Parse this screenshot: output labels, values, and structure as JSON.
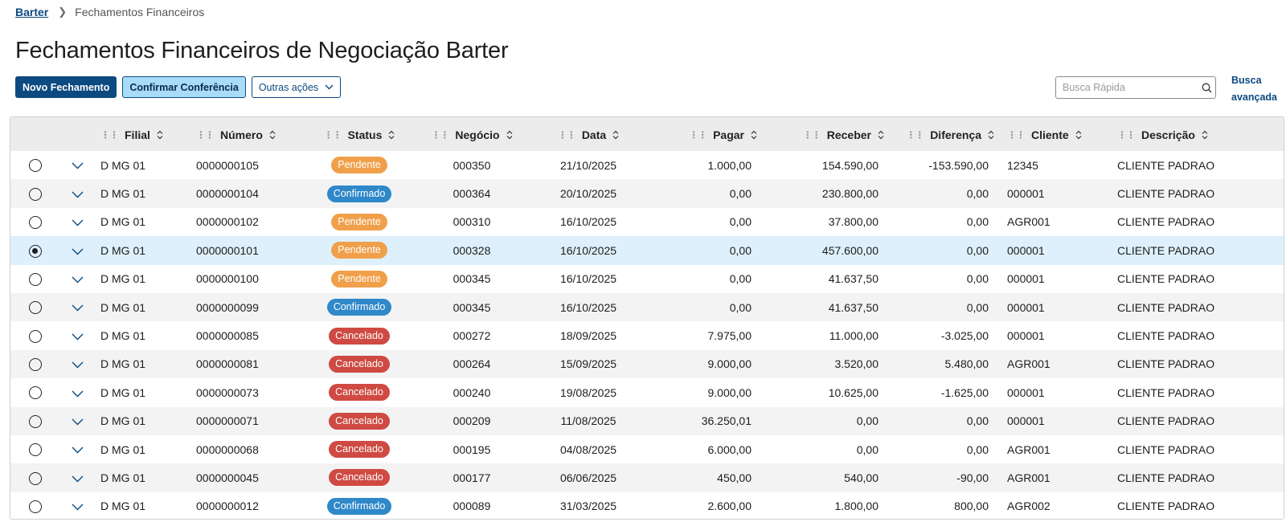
{
  "breadcrumb": {
    "root": "Barter",
    "current": "Fechamentos Financeiros"
  },
  "page_title": "Fechamentos Financeiros de Negociação Barter",
  "toolbar": {
    "new_label": "Novo Fechamento",
    "confirm_label": "Confirmar Conferência",
    "more_label": "Outras ações"
  },
  "search": {
    "placeholder": "Busca Rápida",
    "icon": "search-icon"
  },
  "advanced_search": {
    "line1": "Busca",
    "line2": "avançada"
  },
  "colors": {
    "primary": "#0c4a80",
    "secondary_bg": "#a8dcf8",
    "pendente": "#f0a04a",
    "confirmado": "#2f88c9",
    "cancelado": "#cf4a43",
    "selected_row": "#def0fb"
  },
  "columns": [
    "Filial",
    "Número",
    "Status",
    "Negócio",
    "Data",
    "Pagar",
    "Receber",
    "Diferença",
    "Cliente",
    "Descrição"
  ],
  "rows": [
    {
      "selected": false,
      "filial": "D MG 01",
      "numero": "0000000105",
      "status": "Pendente",
      "negocio": "000350",
      "data": "21/10/2025",
      "pagar": "1.000,00",
      "receber": "154.590,00",
      "diferenca": "-153.590,00",
      "cliente": "12345",
      "descricao": "CLIENTE PADRAO"
    },
    {
      "selected": false,
      "filial": "D MG 01",
      "numero": "0000000104",
      "status": "Confirmado",
      "negocio": "000364",
      "data": "20/10/2025",
      "pagar": "0,00",
      "receber": "230.800,00",
      "diferenca": "0,00",
      "cliente": "000001",
      "descricao": "CLIENTE PADRAO"
    },
    {
      "selected": false,
      "filial": "D MG 01",
      "numero": "0000000102",
      "status": "Pendente",
      "negocio": "000310",
      "data": "16/10/2025",
      "pagar": "0,00",
      "receber": "37.800,00",
      "diferenca": "0,00",
      "cliente": "AGR001",
      "descricao": "CLIENTE PADRAO"
    },
    {
      "selected": true,
      "filial": "D MG 01",
      "numero": "0000000101",
      "status": "Pendente",
      "negocio": "000328",
      "data": "16/10/2025",
      "pagar": "0,00",
      "receber": "457.600,00",
      "diferenca": "0,00",
      "cliente": "000001",
      "descricao": "CLIENTE PADRAO"
    },
    {
      "selected": false,
      "filial": "D MG 01",
      "numero": "0000000100",
      "status": "Pendente",
      "negocio": "000345",
      "data": "16/10/2025",
      "pagar": "0,00",
      "receber": "41.637,50",
      "diferenca": "0,00",
      "cliente": "000001",
      "descricao": "CLIENTE PADRAO"
    },
    {
      "selected": false,
      "filial": "D MG 01",
      "numero": "0000000099",
      "status": "Confirmado",
      "negocio": "000345",
      "data": "16/10/2025",
      "pagar": "0,00",
      "receber": "41.637,50",
      "diferenca": "0,00",
      "cliente": "000001",
      "descricao": "CLIENTE PADRAO"
    },
    {
      "selected": false,
      "filial": "D MG 01",
      "numero": "0000000085",
      "status": "Cancelado",
      "negocio": "000272",
      "data": "18/09/2025",
      "pagar": "7.975,00",
      "receber": "11.000,00",
      "diferenca": "-3.025,00",
      "cliente": "000001",
      "descricao": "CLIENTE PADRAO"
    },
    {
      "selected": false,
      "filial": "D MG 01",
      "numero": "0000000081",
      "status": "Cancelado",
      "negocio": "000264",
      "data": "15/09/2025",
      "pagar": "9.000,00",
      "receber": "3.520,00",
      "diferenca": "5.480,00",
      "cliente": "AGR001",
      "descricao": "CLIENTE PADRAO"
    },
    {
      "selected": false,
      "filial": "D MG 01",
      "numero": "0000000073",
      "status": "Cancelado",
      "negocio": "000240",
      "data": "19/08/2025",
      "pagar": "9.000,00",
      "receber": "10.625,00",
      "diferenca": "-1.625,00",
      "cliente": "000001",
      "descricao": "CLIENTE PADRAO"
    },
    {
      "selected": false,
      "filial": "D MG 01",
      "numero": "0000000071",
      "status": "Cancelado",
      "negocio": "000209",
      "data": "11/08/2025",
      "pagar": "36.250,01",
      "receber": "0,00",
      "diferenca": "0,00",
      "cliente": "000001",
      "descricao": "CLIENTE PADRAO"
    },
    {
      "selected": false,
      "filial": "D MG 01",
      "numero": "0000000068",
      "status": "Cancelado",
      "negocio": "000195",
      "data": "04/08/2025",
      "pagar": "6.000,00",
      "receber": "0,00",
      "diferenca": "0,00",
      "cliente": "AGR001",
      "descricao": "CLIENTE PADRAO"
    },
    {
      "selected": false,
      "filial": "D MG 01",
      "numero": "0000000045",
      "status": "Cancelado",
      "negocio": "000177",
      "data": "06/06/2025",
      "pagar": "450,00",
      "receber": "540,00",
      "diferenca": "-90,00",
      "cliente": "AGR001",
      "descricao": "CLIENTE PADRAO"
    },
    {
      "selected": false,
      "filial": "D MG 01",
      "numero": "0000000012",
      "status": "Confirmado",
      "negocio": "000089",
      "data": "31/03/2025",
      "pagar": "2.600,00",
      "receber": "1.800,00",
      "diferenca": "800,00",
      "cliente": "AGR002",
      "descricao": "CLIENTE PADRAO"
    }
  ]
}
